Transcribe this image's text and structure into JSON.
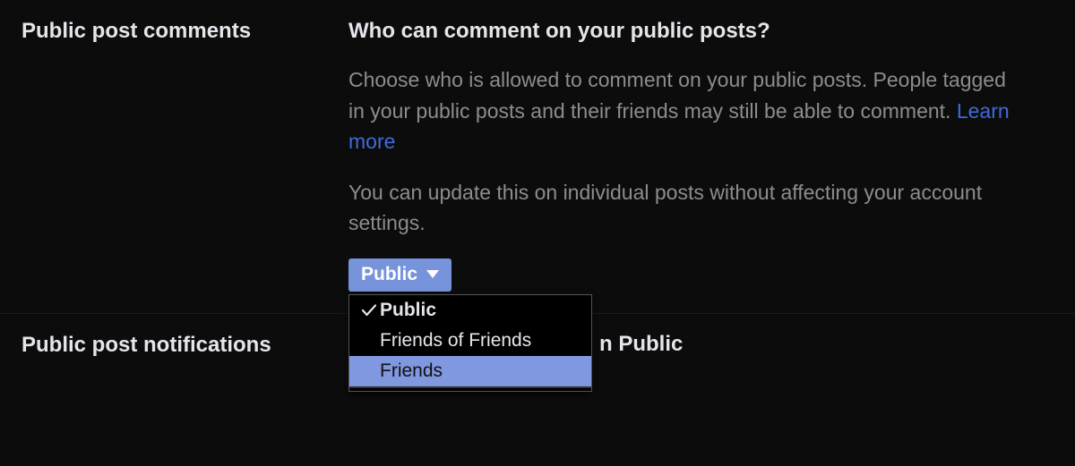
{
  "section1": {
    "left_title": "Public post comments",
    "question": "Who can comment on your public posts?",
    "desc1_prefix": "Choose who is allowed to comment on your public posts. People tagged in your public posts and their friends may still be able to comment. ",
    "learn_more": "Learn more",
    "desc2": "You can update this on individual posts without affecting your account settings.",
    "dropdown": {
      "selected_label": "Public",
      "options": [
        {
          "label": "Public",
          "selected": true,
          "highlight": false
        },
        {
          "label": "Friends of Friends",
          "selected": false,
          "highlight": false
        },
        {
          "label": "Friends",
          "selected": false,
          "highlight": true
        }
      ]
    }
  },
  "section2": {
    "left_title": "Public post notifications",
    "right_partial_visible": "n Public"
  }
}
